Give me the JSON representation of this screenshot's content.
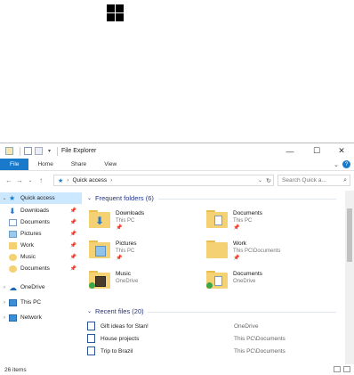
{
  "window": {
    "title": "File Explorer",
    "tabs": [
      "File",
      "Home",
      "Share",
      "View"
    ],
    "controls": {
      "minimize": "—",
      "maximize": "☐",
      "close": "✕"
    }
  },
  "address": {
    "path": "Quick access",
    "search_placeholder": "Search Quick a..."
  },
  "nav": {
    "items": [
      {
        "label": "Quick access",
        "icon": "star-icon",
        "selected": true
      },
      {
        "label": "Downloads",
        "icon": "downloads-icon",
        "pinned": true
      },
      {
        "label": "Documents",
        "icon": "documents-icon",
        "pinned": true
      },
      {
        "label": "Pictures",
        "icon": "pictures-icon",
        "pinned": true
      },
      {
        "label": "Work",
        "icon": "folder-icon",
        "pinned": true
      },
      {
        "label": "Music",
        "icon": "music-icon",
        "pinned": true
      },
      {
        "label": "Documents",
        "icon": "documents-icon",
        "pinned": true
      },
      {
        "label": "OneDrive",
        "icon": "cloud-icon"
      },
      {
        "label": "This PC",
        "icon": "computer-icon"
      },
      {
        "label": "Network",
        "icon": "network-icon"
      }
    ]
  },
  "frequent": {
    "header": "Frequent folders (6)",
    "folders": [
      {
        "name": "Downloads",
        "location": "This PC"
      },
      {
        "name": "Documents",
        "location": "This PC"
      },
      {
        "name": "Pictures",
        "location": "This PC"
      },
      {
        "name": "Work",
        "location": "This PC\\Documents"
      },
      {
        "name": "Music",
        "location": "OneDrive"
      },
      {
        "name": "Documents",
        "location": "OneDrive"
      }
    ]
  },
  "recent": {
    "header": "Recent files (20)",
    "files": [
      {
        "name": "Gift ideas for Stan!",
        "location": "OneDrive"
      },
      {
        "name": "House projects",
        "location": "This PC\\Documents"
      },
      {
        "name": "Trip to Brazil",
        "location": "This PC\\Documents"
      }
    ]
  },
  "status": {
    "items": "26 items"
  },
  "colors": {
    "accent": "#1979ca",
    "selected": "#cce8ff",
    "section": "#1e3287",
    "folder": "#f4d274"
  }
}
